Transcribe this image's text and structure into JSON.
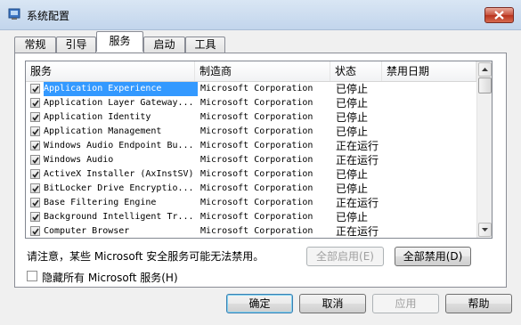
{
  "window": {
    "title": "系统配置",
    "icon": "msconfig-icon"
  },
  "tabs": [
    {
      "label": "常规",
      "active": false
    },
    {
      "label": "引导",
      "active": false
    },
    {
      "label": "服务",
      "active": true
    },
    {
      "label": "启动",
      "active": false
    },
    {
      "label": "工具",
      "active": false
    }
  ],
  "columns": {
    "service": "服务",
    "manufacturer": "制造商",
    "status": "状态",
    "disabled_date": "禁用日期"
  },
  "services": [
    {
      "name": "Application Experience",
      "manufacturer": "Microsoft Corporation",
      "status": "已停止",
      "checked": true,
      "selected": true
    },
    {
      "name": "Application Layer Gateway...",
      "manufacturer": "Microsoft Corporation",
      "status": "已停止",
      "checked": true
    },
    {
      "name": "Application Identity",
      "manufacturer": "Microsoft Corporation",
      "status": "已停止",
      "checked": true
    },
    {
      "name": "Application Management",
      "manufacturer": "Microsoft Corporation",
      "status": "已停止",
      "checked": true
    },
    {
      "name": "Windows Audio Endpoint Bu...",
      "manufacturer": "Microsoft Corporation",
      "status": "正在运行",
      "checked": true
    },
    {
      "name": "Windows Audio",
      "manufacturer": "Microsoft Corporation",
      "status": "正在运行",
      "checked": true
    },
    {
      "name": "ActiveX Installer (AxInstSV)",
      "manufacturer": "Microsoft Corporation",
      "status": "已停止",
      "checked": true
    },
    {
      "name": "BitLocker Drive Encryptio...",
      "manufacturer": "Microsoft Corporation",
      "status": "已停止",
      "checked": true
    },
    {
      "name": "Base Filtering Engine",
      "manufacturer": "Microsoft Corporation",
      "status": "正在运行",
      "checked": true
    },
    {
      "name": "Background Intelligent Tr...",
      "manufacturer": "Microsoft Corporation",
      "status": "已停止",
      "checked": true
    },
    {
      "name": "Computer Browser",
      "manufacturer": "Microsoft Corporation",
      "status": "正在运行",
      "checked": true
    }
  ],
  "notice": "请注意，某些 Microsoft 安全服务可能无法禁用。",
  "buttons": {
    "enable_all": "全部启用(E)",
    "disable_all": "全部禁用(D)",
    "ok": "确定",
    "cancel": "取消",
    "apply": "应用",
    "help": "帮助"
  },
  "hide_ms": {
    "label": "隐藏所有 Microsoft 服务(H)",
    "checked": false
  },
  "colors": {
    "selection": "#3399ff",
    "title_gradient_top": "#d9e6f4",
    "close_red": "#c7503c"
  }
}
